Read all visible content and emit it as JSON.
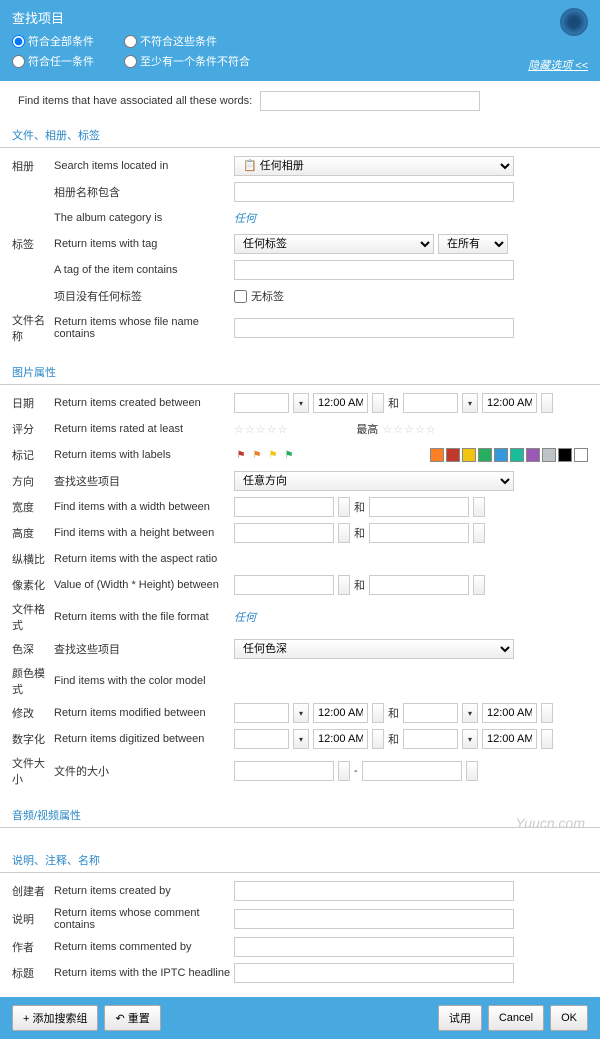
{
  "header": {
    "title": "查找项目",
    "radios": {
      "all": "符合全部条件",
      "notall": "不符合这些条件",
      "any": "符合任一条件",
      "atleast": "至少有一个条件不符合"
    },
    "hide_options": "隐藏选项 <<"
  },
  "search": {
    "label": "Find items that have associated all these words:"
  },
  "sections": {
    "file_album_tag": "文件、相册、标签",
    "image_props": "图片属性",
    "av_props": "音频/视频属性",
    "desc_notes": "说明、注释、名称"
  },
  "album": {
    "label": "相册",
    "located": "Search items located in",
    "located_val": "📋 任何相册",
    "name_contains": "相册名称包含",
    "category": "The album category is",
    "category_val": "任何"
  },
  "tag": {
    "label": "标签",
    "with_tag": "Return items with tag",
    "with_tag_val": "任何标签",
    "in_all": "在所有",
    "contains": "A tag of the item contains",
    "no_tag": "项目没有任何标签",
    "no_tag_val": "无标签"
  },
  "filename": {
    "label": "文件名称",
    "desc": "Return items whose file name contains"
  },
  "image": {
    "date": {
      "label": "日期",
      "desc": "Return items created between",
      "time": "12:00 AM",
      "and": "和"
    },
    "rating": {
      "label": "评分",
      "desc": "Return items rated at least",
      "max": "最高"
    },
    "marks": {
      "label": "标记",
      "desc": "Return items with labels"
    },
    "direction": {
      "label": "方向",
      "desc": "查找这些项目",
      "val": "任意方向"
    },
    "width": {
      "label": "宽度",
      "desc": "Find items with a width between",
      "and": "和"
    },
    "height": {
      "label": "高度",
      "desc": "Find items with a height between",
      "and": "和"
    },
    "aspect": {
      "label": "纵横比",
      "desc": "Return items with the aspect ratio"
    },
    "pixels": {
      "label": "像素化",
      "desc": "Value of (Width * Height) between",
      "and": "和"
    },
    "format": {
      "label": "文件格式",
      "desc": "Return items with the file format",
      "val": "任何"
    },
    "depth": {
      "label": "色深",
      "desc": "查找这些项目",
      "val": "任何色深"
    },
    "colormodel": {
      "label": "颜色模式",
      "desc": "Find items with the color model"
    },
    "modified": {
      "label": "修改",
      "desc": "Return items modified between",
      "time": "12:00 AM",
      "and": "和"
    },
    "digitized": {
      "label": "数字化",
      "desc": "Return items digitized between",
      "time": "12:00 AM",
      "and": "和"
    },
    "filesize": {
      "label": "文件大小",
      "desc": "文件的大小",
      "dash": "-"
    }
  },
  "desc": {
    "creator": {
      "label": "创建者",
      "desc": "Return items created by"
    },
    "comment": {
      "label": "说明",
      "desc": "Return items whose comment contains"
    },
    "author": {
      "label": "作者",
      "desc": "Return items commented by"
    },
    "headline": {
      "label": "标题",
      "desc": "Return items with the IPTC headline"
    }
  },
  "footer": {
    "add_group": "+ 添加搜索组",
    "reset": "↶ 重置",
    "try": "试用",
    "cancel": "Cancel",
    "ok": "OK"
  },
  "watermark": "Yuucn.com",
  "colors": [
    "#ff7f27",
    "#c0392b",
    "#f1c40f",
    "#27ae60",
    "#3498db",
    "#1abc9c",
    "#9b59b6",
    "#bdc3c7",
    "#000000",
    "#ffffff"
  ]
}
